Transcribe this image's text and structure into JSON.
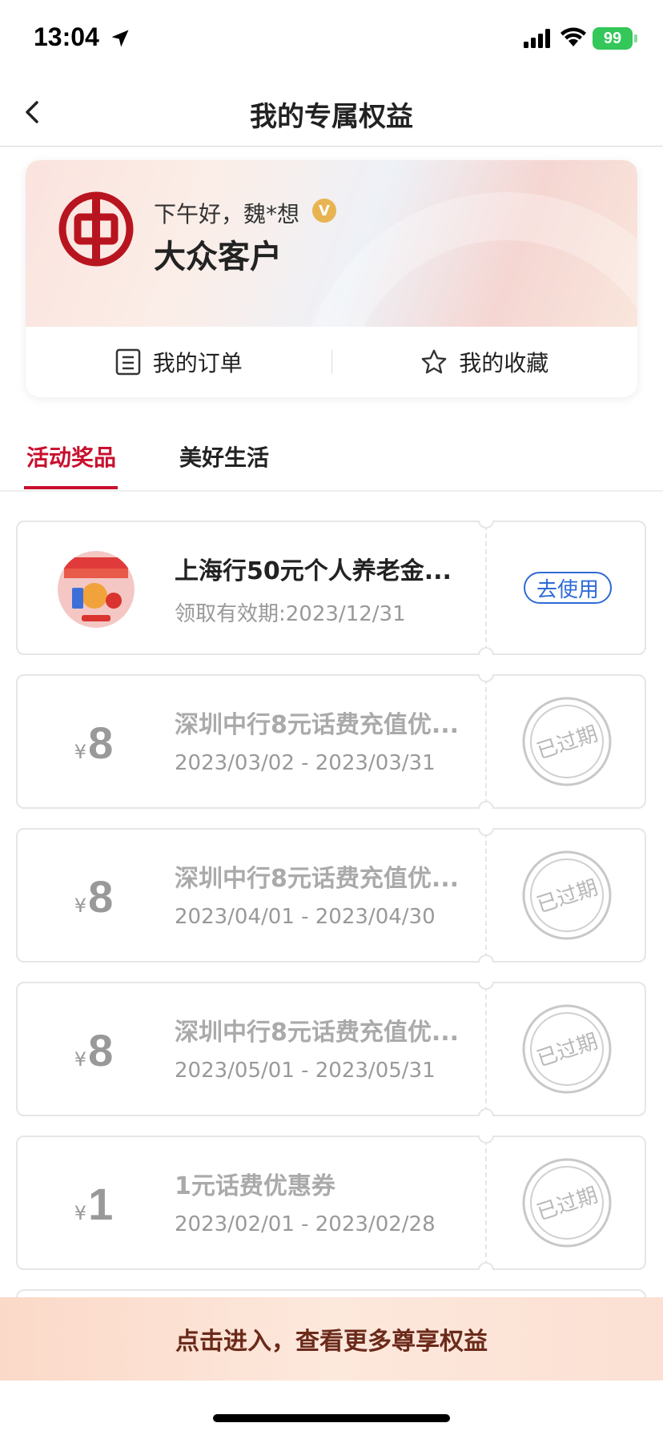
{
  "status_bar": {
    "time": "13:04",
    "battery": "99"
  },
  "nav": {
    "title": "我的专属权益"
  },
  "profile": {
    "greeting": "下午好，魏*想",
    "vip_badge": "V",
    "tier": "大众客户",
    "actions": [
      {
        "label": "我的订单",
        "icon": "list-icon"
      },
      {
        "label": "我的收藏",
        "icon": "star-icon"
      }
    ]
  },
  "tabs": [
    {
      "label": "活动奖品",
      "active": true
    },
    {
      "label": "美好生活",
      "active": false
    }
  ],
  "coupons": [
    {
      "title": "上海行50元个人养老金...",
      "date": "领取有效期:2023/12/31",
      "action": "去使用",
      "status": "active",
      "image": "prize-thumbnail"
    },
    {
      "yen": "¥",
      "amount": "8",
      "title": "深圳中行8元话费充值优...",
      "date": "2023/03/02 - 2023/03/31",
      "status": "已过期"
    },
    {
      "yen": "¥",
      "amount": "8",
      "title": "深圳中行8元话费充值优...",
      "date": "2023/04/01 - 2023/04/30",
      "status": "已过期"
    },
    {
      "yen": "¥",
      "amount": "8",
      "title": "深圳中行8元话费充值优...",
      "date": "2023/05/01 - 2023/05/31",
      "status": "已过期"
    },
    {
      "yen": "¥",
      "amount": "1",
      "title": "1元话费优惠券",
      "date": "2023/02/01 - 2023/02/28",
      "status": "已过期"
    }
  ],
  "banner": {
    "text": "点击进入，查看更多尊享权益"
  },
  "colors": {
    "accent": "#c8102e",
    "link": "#2f6bd6",
    "battery": "#34c759"
  }
}
